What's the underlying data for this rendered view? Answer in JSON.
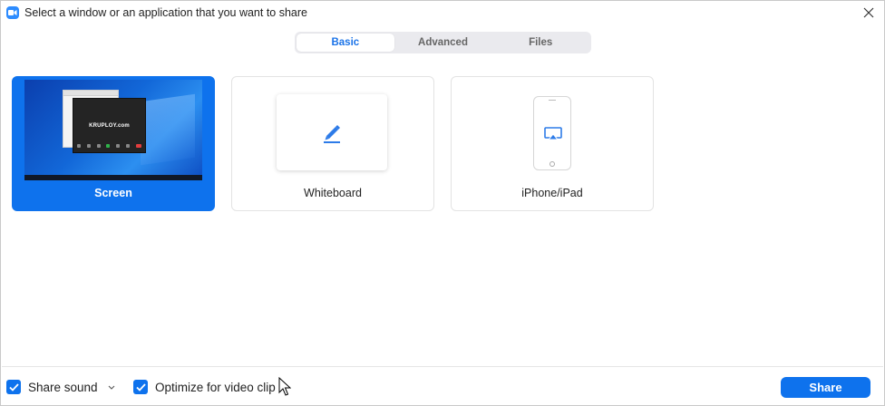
{
  "window": {
    "title": "Select a window or an application that you want to share",
    "accent_color": "#0e72ed"
  },
  "tabs": [
    {
      "label": "Basic",
      "active": true
    },
    {
      "label": "Advanced",
      "active": false
    },
    {
      "label": "Files",
      "active": false
    }
  ],
  "cards": [
    {
      "label": "Screen",
      "selected": true,
      "icon": "desktop-preview"
    },
    {
      "label": "Whiteboard",
      "selected": false,
      "icon": "pen-icon"
    },
    {
      "label": "iPhone/iPad",
      "selected": false,
      "icon": "airplay-icon"
    }
  ],
  "screen_preview": {
    "window_text": "KRUPLOY.com"
  },
  "bottom": {
    "share_sound_label": "Share sound",
    "share_sound_checked": true,
    "optimize_label": "Optimize for video clip",
    "optimize_checked": true,
    "share_button_label": "Share"
  }
}
